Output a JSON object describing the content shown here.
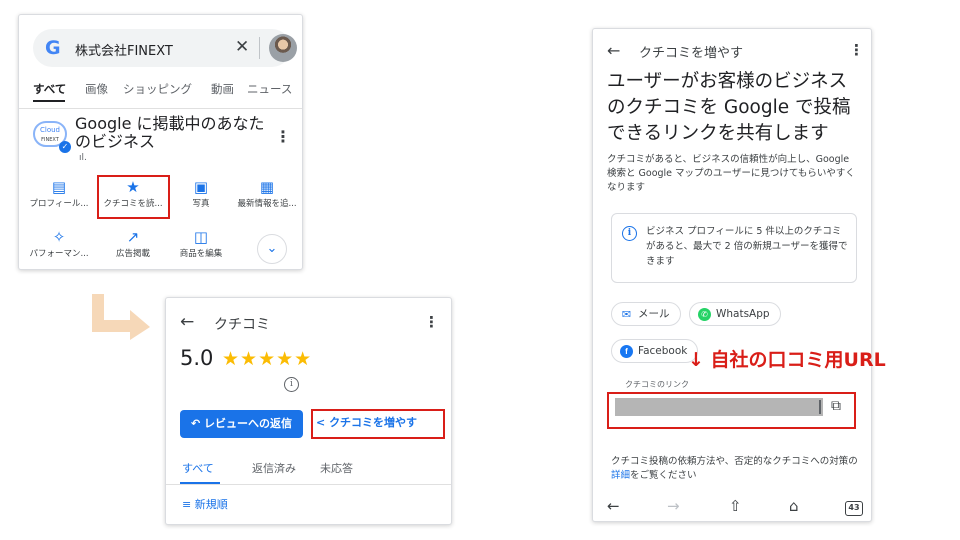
{
  "colors": {
    "accent": "#1a73e8",
    "highlight": "#d91e18",
    "star": "#fbbc04",
    "arrow": "#f6d8b8"
  },
  "search_panel": {
    "logo": "G",
    "query": "株式会社FINEXT",
    "clear": "✕",
    "tabs": [
      "すべて",
      "画像",
      "ショッピング",
      "動画",
      "ニュース"
    ],
    "business_name": "Google に掲載中のあなたのビジネス",
    "logo_text": [
      "Cloud",
      "FINEXT"
    ],
    "insights_icon": "bar-chart-icon",
    "more": "⋮",
    "actions": [
      {
        "icon": "storefront-icon",
        "glyph": "▤",
        "label": "プロフィール..."
      },
      {
        "icon": "review-star-icon",
        "glyph": "★",
        "label": "クチコミを読..."
      },
      {
        "icon": "photo-icon",
        "glyph": "▣",
        "label": "写真"
      },
      {
        "icon": "post-add-icon",
        "glyph": "▦",
        "label": "最新情報を追..."
      },
      {
        "icon": "sparkle-chart-icon",
        "glyph": "✧",
        "label": "パフォーマン..."
      },
      {
        "icon": "trending-up-icon",
        "glyph": "↗",
        "label": "広告掲載"
      },
      {
        "icon": "shopping-bag-icon",
        "glyph": "◫",
        "label": "商品を編集"
      }
    ],
    "expand": "⌄"
  },
  "reviews_panel": {
    "back": "←",
    "title": "クチコミ",
    "more": "⋮",
    "rating": "5.0",
    "stars": "★★★★★",
    "info": "i",
    "reply_button": "レビューへの返信",
    "reply_icon": "↶",
    "get_reviews_button": "クチコミを増やす",
    "share_icon": "<",
    "tabs": [
      "すべて",
      "返信済み",
      "未応答"
    ],
    "sort_icon": "≡",
    "sort_label": "新規順"
  },
  "share_panel": {
    "back": "←",
    "top_title": "クチコミを増やす",
    "more": "⋮",
    "headline": "ユーザーがお客様のビジネスのクチコミを Google で投稿できるリンクを共有します",
    "description": "クチコミがあると、ビジネスの信頼性が向上し、Google 検索と Google マップのユーザーに見つけてもらいやすくなります",
    "info_icon": "i",
    "info_box": "ビジネス プロフィールに 5 件以上のクチコミがあると、最大で 2 倍の新規ユーザーを獲得できます",
    "share_chips": [
      {
        "label": "メール",
        "icon": "mail-icon",
        "glyph": "✉"
      },
      {
        "label": "WhatsApp",
        "icon": "whatsapp-icon",
        "glyph": "✆"
      },
      {
        "label": "Facebook",
        "icon": "facebook-icon",
        "glyph": "f"
      }
    ],
    "link_label": "クチコミのリンク",
    "copy_icon": "⧉",
    "footer_before": "クチコミ投稿の依頼方法や、否定的なクチコミへの対策の",
    "footer_link": "詳細",
    "footer_after": "をご覧ください",
    "nav": {
      "back": "←",
      "forward": "→",
      "share": "⇧",
      "home": "⌂",
      "tabs": "43"
    }
  },
  "annotation": "↓ 自社の口コミ用URL"
}
